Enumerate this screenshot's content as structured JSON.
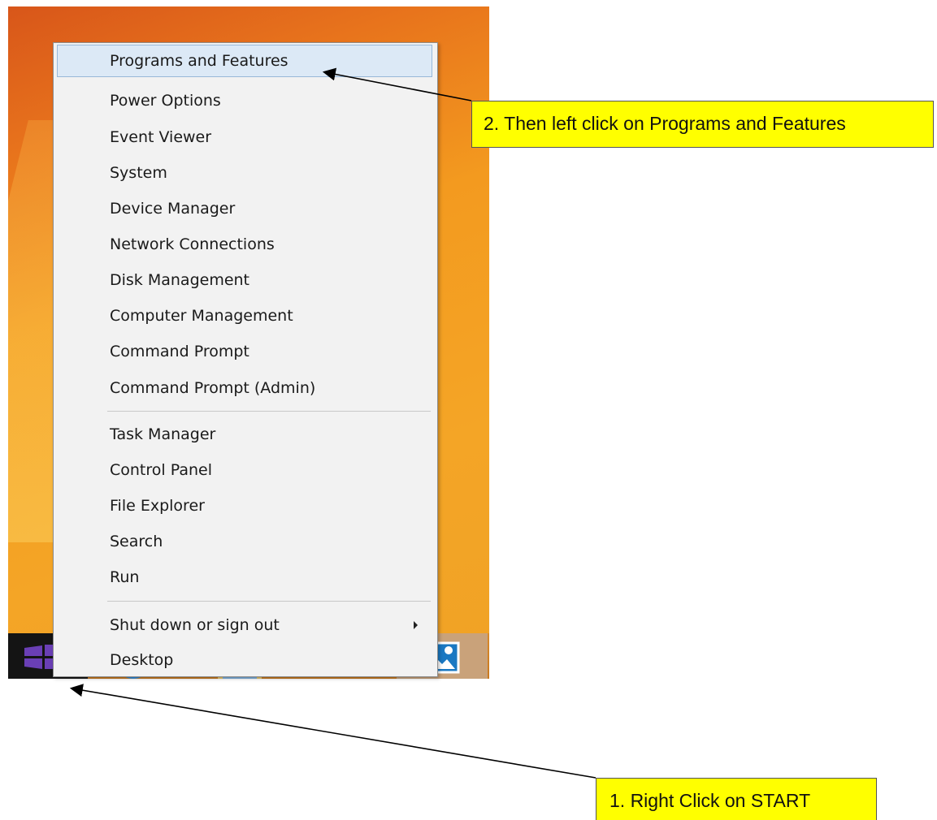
{
  "menu": {
    "items": [
      {
        "label": "Programs and Features",
        "highlighted": true
      },
      {
        "label": "Power Options"
      },
      {
        "label": "Event Viewer"
      },
      {
        "label": "System"
      },
      {
        "label": "Device Manager"
      },
      {
        "label": "Network Connections"
      },
      {
        "label": "Disk Management"
      },
      {
        "label": "Computer Management"
      },
      {
        "label": "Command Prompt"
      },
      {
        "label": "Command Prompt (Admin)"
      },
      {
        "label": "Task Manager"
      },
      {
        "label": "Control Panel"
      },
      {
        "label": "File Explorer"
      },
      {
        "label": "Search"
      },
      {
        "label": "Run"
      },
      {
        "label": "Shut down or sign out",
        "submenu": true
      },
      {
        "label": "Desktop"
      }
    ]
  },
  "callouts": {
    "step2": "2. Then left click on Programs and Features",
    "step1": "1. Right Click on START"
  },
  "taskbar": {
    "icons": [
      "windows-start-icon",
      "internet-explorer-icon",
      "file-explorer-icon",
      "store-icon",
      "photos-icon"
    ]
  },
  "colors": {
    "callout_bg": "#ffff00",
    "menu_bg": "#f2f2f2",
    "highlight_bg": "#dce9f6",
    "desktop_orange": "#f39a1f"
  }
}
